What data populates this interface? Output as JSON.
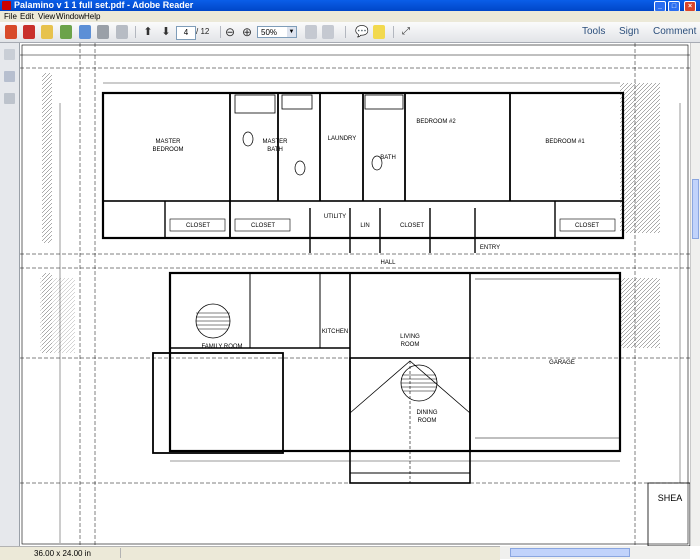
{
  "window": {
    "title": "Palamino v 1 1 full set.pdf - Adobe Reader"
  },
  "menu": [
    "File",
    "Edit",
    "View",
    "Window",
    "Help"
  ],
  "toolbar": {
    "page_current": "4",
    "page_total": "/ 12",
    "zoom": "50%",
    "tools": "Tools",
    "sign": "Sign",
    "comment": "Comment"
  },
  "status": {
    "page_size": "36.00 x 24.00 in"
  },
  "colors": {
    "titlebar": "#0a5ee8",
    "accent_red": "#cc0000",
    "link_blue": "#2c4f7c"
  },
  "drawing": {
    "rooms": [
      {
        "label": "MASTER"
      },
      {
        "label": "BEDROOM"
      },
      {
        "label": "MASTER"
      },
      {
        "label": "BATH"
      },
      {
        "label": "LAUNDRY"
      },
      {
        "label": "BATH"
      },
      {
        "label": "BEDROOM #2"
      },
      {
        "label": "BEDROOM #1"
      },
      {
        "label": "CLOSET"
      },
      {
        "label": "CLOSET"
      },
      {
        "label": "UTILITY"
      },
      {
        "label": "LIN"
      },
      {
        "label": "CLOSET"
      },
      {
        "label": "CLOSET"
      },
      {
        "label": "ENTRY"
      },
      {
        "label": "HALL"
      },
      {
        "label": "KITCHEN"
      },
      {
        "label": "LIVING"
      },
      {
        "label": "ROOM"
      },
      {
        "label": "FAMILY ROOM"
      },
      {
        "label": "GARAGE"
      },
      {
        "label": "DINING"
      },
      {
        "label": "ROOM"
      },
      {
        "label": "SHEA"
      }
    ]
  }
}
